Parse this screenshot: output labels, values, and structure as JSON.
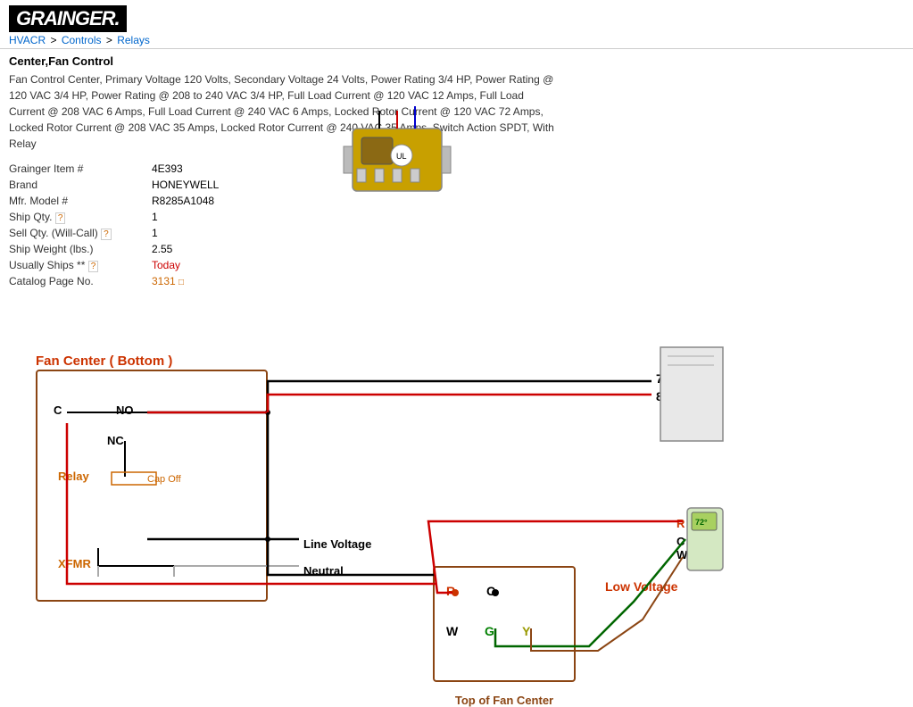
{
  "header": {
    "logo": "GRAINGER.",
    "breadcrumb": [
      "HVACR",
      "Controls",
      "Relays"
    ]
  },
  "product": {
    "title": "Center,Fan Control",
    "description": "Fan Control Center, Primary Voltage 120 Volts, Secondary Voltage 24 Volts, Power Rating 3/4 HP, Power Rating @ 120 VAC 3/4 HP, Power Rating @ 208 to 240 VAC 3/4 HP, Full Load Current @ 120 VAC 12 Amps, Full Load Current @ 208 VAC 6 Amps, Full Load Current @ 240 VAC 6 Amps, Locked Rotor Current @ 120 VAC 72 Amps, Locked Rotor Current @ 208 VAC 35 Amps, Locked Rotor Current @ 240 VAC 35 Amps, Switch Action SPDT, With Relay"
  },
  "specs": {
    "item_label": "Grainger Item #",
    "item_value": "4E393",
    "brand_label": "Brand",
    "brand_value": "HONEYWELL",
    "mfr_label": "Mfr. Model #",
    "mfr_value": "R8285A1048",
    "ship_qty_label": "Ship Qty.",
    "ship_qty_value": "1",
    "sell_qty_label": "Sell Qty. (Will-Call)",
    "sell_qty_value": "1",
    "ship_weight_label": "Ship Weight (lbs.)",
    "ship_weight_value": "2.55",
    "usually_ships_label": "Usually Ships **",
    "usually_ships_value": "Today",
    "catalog_label": "Catalog Page No.",
    "catalog_value": "3131"
  },
  "diagram": {
    "fan_center_bottom_label": "Fan Center ( Bottom )",
    "top_fan_center_label": "Top of Fan Center",
    "low_voltage_label": "Low Voltage",
    "relay_label": "Relay",
    "xfmr_label": "XFMR",
    "line_voltage_label": "Line Voltage",
    "neutral_label": "Neutral",
    "cap_off_label": "Cap Off",
    "terminal_c": "C",
    "terminal_no": "NO",
    "terminal_nc": "NC",
    "terminal_r": "R",
    "terminal_w": "W",
    "terminal_g": "G",
    "terminal_y": "Y",
    "num_7": "7",
    "num_8": "8",
    "therm_r": "R",
    "therm_c": "C",
    "therm_w": "W"
  }
}
